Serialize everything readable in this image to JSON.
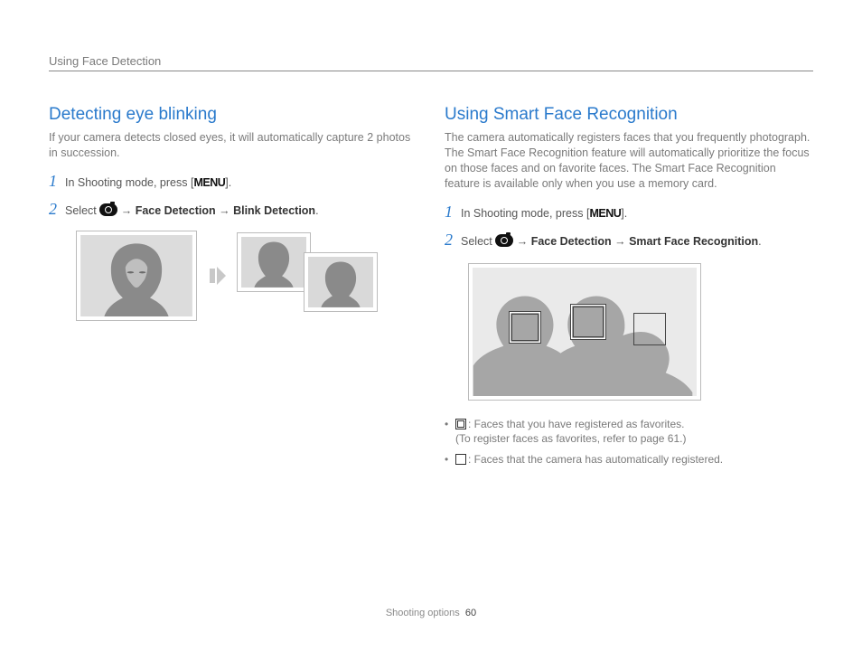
{
  "header": {
    "section": "Using Face Detection"
  },
  "left": {
    "title": "Detecting eye blinking",
    "intro": "If your camera detects closed eyes, it will automatically capture 2 photos in succession.",
    "step1_pre": "In Shooting mode, press [",
    "step1_menu": "MENU",
    "step1_post": "].",
    "step2_pre": "Select ",
    "step2_fd": "Face Detection",
    "step2_bd": "Blink Detection",
    "arrow": "→",
    "dot": "."
  },
  "right": {
    "title": "Using Smart Face Recognition",
    "intro": "The camera automatically registers faces that you frequently photograph. The Smart Face Recognition feature will automatically prioritize the focus on those faces and on favorite faces. The Smart Face Recognition feature is available only when you use a memory card.",
    "step1_pre": "In Shooting mode, press [",
    "step1_menu": "MENU",
    "step1_post": "].",
    "step2_pre": "Select ",
    "step2_fd": "Face Detection",
    "step2_sfr": "Smart Face Recognition",
    "arrow": "→",
    "dot": ".",
    "bullet1a": ": Faces that you have registered as favorites.",
    "bullet1b": "(To register faces as favorites, refer to page 61.)",
    "bullet2": ": Faces that the camera has automatically registered."
  },
  "footer": {
    "section": "Shooting options",
    "page": "60"
  }
}
